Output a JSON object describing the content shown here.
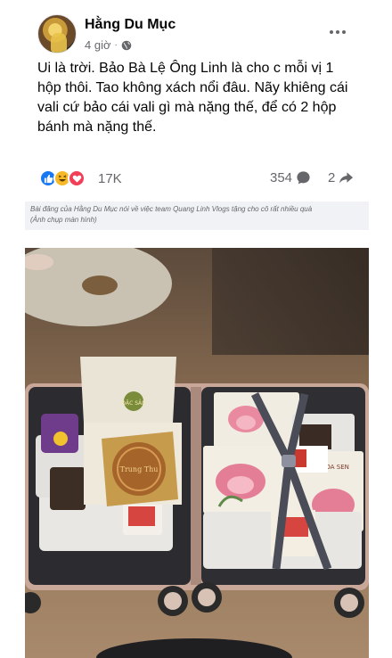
{
  "post": {
    "author": "Hằng Du Mục",
    "time": "4 giờ",
    "privacy_icon": "globe-icon",
    "text": "Ui là trời. Bảo Bà Lệ Ông Linh là cho c mỗi vị 1 hộp thôi. Tao không xách nổi đâu. Nãy khiêng cái vali cứ bảo cái vali gì mà nặng thế, để có 2 hộp bánh mà nặng thế.",
    "reactions": {
      "icons": [
        "like-icon",
        "haha-icon",
        "love-icon"
      ],
      "count": "17K",
      "comments": "354",
      "shares": "2"
    }
  },
  "caption": {
    "line1": "Bài đăng của Hằng Du Mục nói về việc team Quang Linh Vlogs tặng cho cô rất nhiều quà",
    "line2": "(Ảnh chụp màn hình)"
  },
  "photo": {
    "box_lid_text": "ĐẶC SẢN",
    "tray_text": "Trung Thu",
    "box_label_right": "HOA SEN"
  },
  "colors": {
    "like": "#1877f2",
    "haha": "#f7b928",
    "love": "#f33e58",
    "secondary_text": "#65676b",
    "caption_bg": "#f0f2f5"
  }
}
